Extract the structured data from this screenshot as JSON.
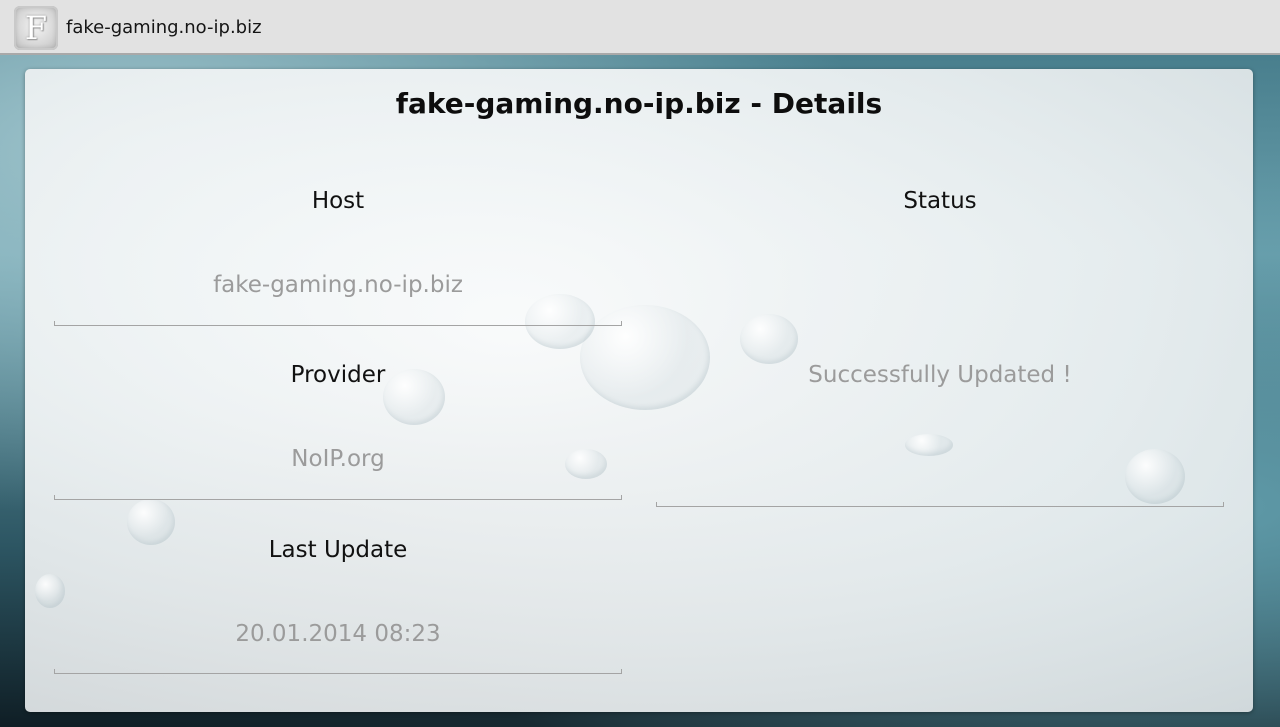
{
  "action_bar": {
    "app_icon_glyph": "F",
    "title": "fake-gaming.no-ip.biz"
  },
  "card": {
    "title": "fake-gaming.no-ip.biz - Details",
    "host": {
      "label": "Host",
      "value": "fake-gaming.no-ip.biz"
    },
    "provider": {
      "label": "Provider",
      "value": "NoIP.org"
    },
    "last_update": {
      "label": "Last Update",
      "value": "20.01.2014 08:23"
    },
    "status": {
      "label": "Status",
      "value": "Successfully Updated !"
    }
  },
  "colors": {
    "action_bar_bg": "#e2e2e2",
    "label_text": "#111111",
    "value_text": "#9b9b9b",
    "underline": "#a4a4a4"
  }
}
